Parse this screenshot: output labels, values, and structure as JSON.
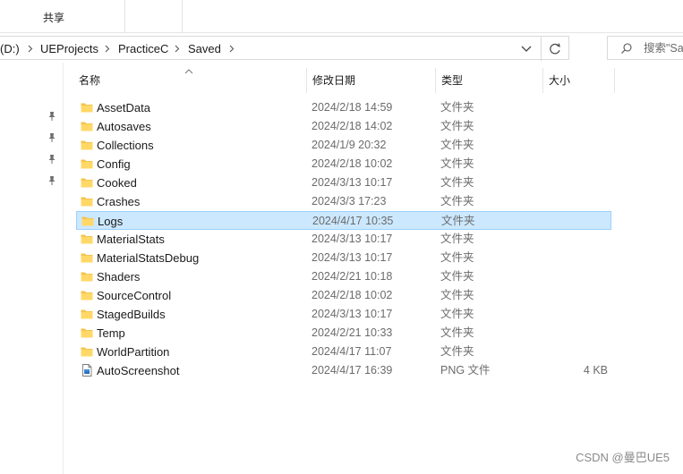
{
  "ribbon": {
    "share_tab": "共享"
  },
  "address_bar": {
    "crumbs": [
      "(D:)",
      "UEProjects",
      "PracticeC",
      "Saved"
    ],
    "dropdown_icon": "chevron-down-icon",
    "refresh_icon": "refresh-icon"
  },
  "search": {
    "placeholder": "搜索\"Saved\"",
    "visible_text": "搜索\"Sav"
  },
  "columns": {
    "name": "名称",
    "date": "修改日期",
    "type": "类型",
    "size": "大小"
  },
  "files": [
    {
      "name": "AssetData",
      "date": "2024/2/18 14:59",
      "type": "文件夹",
      "size": "",
      "icon": "folder-icon"
    },
    {
      "name": "Autosaves",
      "date": "2024/2/18 14:02",
      "type": "文件夹",
      "size": "",
      "icon": "folder-icon"
    },
    {
      "name": "Collections",
      "date": "2024/1/9 20:32",
      "type": "文件夹",
      "size": "",
      "icon": "folder-icon"
    },
    {
      "name": "Config",
      "date": "2024/2/18 10:02",
      "type": "文件夹",
      "size": "",
      "icon": "folder-icon"
    },
    {
      "name": "Cooked",
      "date": "2024/3/13 10:17",
      "type": "文件夹",
      "size": "",
      "icon": "folder-icon"
    },
    {
      "name": "Crashes",
      "date": "2024/3/3 17:23",
      "type": "文件夹",
      "size": "",
      "icon": "folder-icon"
    },
    {
      "name": "Logs",
      "date": "2024/4/17 10:35",
      "type": "文件夹",
      "size": "",
      "icon": "folder-icon",
      "selected": true
    },
    {
      "name": "MaterialStats",
      "date": "2024/3/13 10:17",
      "type": "文件夹",
      "size": "",
      "icon": "folder-icon"
    },
    {
      "name": "MaterialStatsDebug",
      "date": "2024/3/13 10:17",
      "type": "文件夹",
      "size": "",
      "icon": "folder-icon"
    },
    {
      "name": "Shaders",
      "date": "2024/2/21 10:18",
      "type": "文件夹",
      "size": "",
      "icon": "folder-icon"
    },
    {
      "name": "SourceControl",
      "date": "2024/2/18 10:02",
      "type": "文件夹",
      "size": "",
      "icon": "folder-icon"
    },
    {
      "name": "StagedBuilds",
      "date": "2024/3/13 10:17",
      "type": "文件夹",
      "size": "",
      "icon": "folder-icon"
    },
    {
      "name": "Temp",
      "date": "2024/2/21 10:33",
      "type": "文件夹",
      "size": "",
      "icon": "folder-icon"
    },
    {
      "name": "WorldPartition",
      "date": "2024/4/17 11:07",
      "type": "文件夹",
      "size": "",
      "icon": "folder-icon"
    },
    {
      "name": "AutoScreenshot",
      "date": "2024/4/17 16:39",
      "type": "PNG 文件",
      "size": "4 KB",
      "icon": "png-file-icon"
    }
  ],
  "watermark": "CSDN @曼巴UE5",
  "colors": {
    "selection_bg": "#cce8ff",
    "selection_border": "#99d1ff",
    "folder_yellow": "#ffd867",
    "muted_text": "#6b6b6b"
  }
}
